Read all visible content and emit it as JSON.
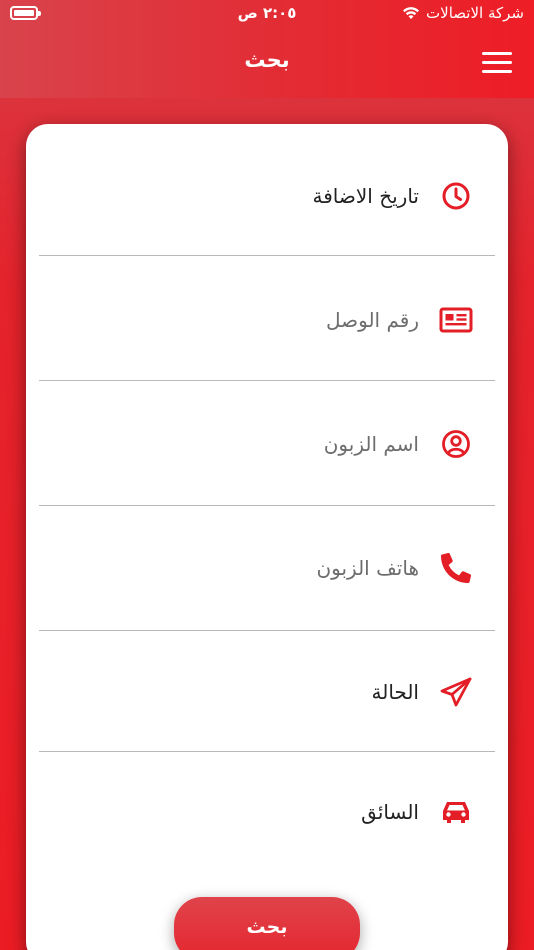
{
  "status_bar": {
    "carrier": "شركة الاتصالات",
    "time": "٢:٠٥ ص"
  },
  "header": {
    "title": "بحث",
    "menu_icon": "hamburger-menu-icon"
  },
  "colors": {
    "accent": "#e31e26",
    "placeholder_text": "#6d6d6d",
    "filled_text": "#222222"
  },
  "search_fields": [
    {
      "label": "تاريخ الاضافة",
      "icon": "clock-icon",
      "state": "filled"
    },
    {
      "label": "رقم الوصل",
      "icon": "receipt-card-icon",
      "state": "placeholder"
    },
    {
      "label": "اسم الزبون",
      "icon": "user-circle-icon",
      "state": "placeholder"
    },
    {
      "label": "هاتف الزبون",
      "icon": "phone-icon",
      "state": "placeholder"
    },
    {
      "label": "الحالة",
      "icon": "paper-plane-icon",
      "state": "filled"
    },
    {
      "label": "السائق",
      "icon": "car-icon",
      "state": "filled"
    }
  ],
  "actions": {
    "search_button": "بحث"
  }
}
